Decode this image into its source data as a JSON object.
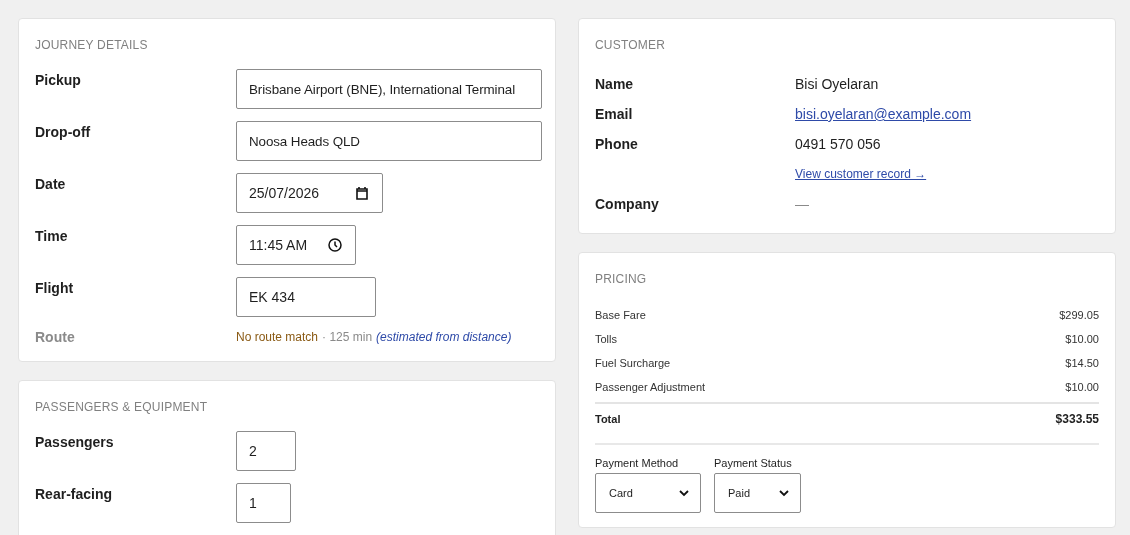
{
  "journey": {
    "title": "JOURNEY DETAILS",
    "fields": [
      {
        "label": "Pickup",
        "kind": "text",
        "value": "Brisbane Airport (BNE), International Terminal"
      },
      {
        "label": "Drop-off",
        "kind": "text",
        "value": "Noosa Heads QLD"
      },
      {
        "label": "Date",
        "kind": "date",
        "value": "25/07/2026"
      },
      {
        "label": "Time",
        "kind": "time",
        "value": "11:45 AM"
      },
      {
        "label": "Flight",
        "kind": "text",
        "value": "EK 434"
      }
    ],
    "route": {
      "label": "Route",
      "status": "No route match",
      "duration": "· 125 min",
      "note": "(estimated from distance)"
    }
  },
  "passengers": {
    "title": "PASSENGERS & EQUIPMENT",
    "fields": [
      {
        "label": "Passengers",
        "value": "2"
      },
      {
        "label": "Rear-facing",
        "value": "1"
      }
    ]
  },
  "customer": {
    "title": "CUSTOMER",
    "rows": [
      {
        "label": "Name",
        "value": "Bisi Oyelaran",
        "kind": "text"
      },
      {
        "label": "Email",
        "value": "bisi.oyelaran@example.com",
        "kind": "link"
      },
      {
        "label": "Phone",
        "value": "0491 570 056",
        "kind": "text"
      },
      {
        "label": "",
        "value": "View customer record →",
        "kind": "small-link"
      },
      {
        "label": "Company",
        "value": "—",
        "kind": "muted"
      }
    ]
  },
  "pricing": {
    "title": "PRICING",
    "lines": [
      {
        "label": "Base Fare",
        "amount": "$299.05"
      },
      {
        "label": "Tolls",
        "amount": "$10.00"
      },
      {
        "label": "Fuel Surcharge",
        "amount": "$14.50"
      },
      {
        "label": "Passenger Adjustment",
        "amount": "$10.00"
      }
    ],
    "total": {
      "label": "Total",
      "amount": "$333.55"
    },
    "selects": [
      {
        "label": "Payment Method",
        "value": "Card"
      },
      {
        "label": "Payment Status",
        "value": "Paid"
      }
    ]
  }
}
